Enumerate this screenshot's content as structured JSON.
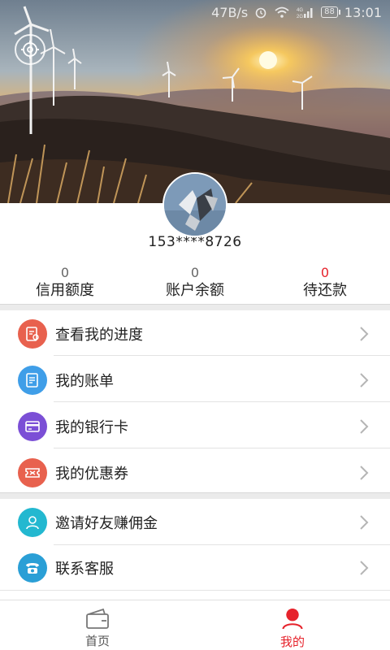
{
  "status_bar": {
    "network_speed": "47B/s",
    "battery": "88",
    "time": "13:01",
    "signal_label": "4G\n2G",
    "icons": [
      "alarm-icon",
      "wifi-icon",
      "signal-icon",
      "battery-icon"
    ]
  },
  "header": {
    "settings_icon": "settings-icon",
    "avatar_icon": "avatar-image"
  },
  "profile": {
    "phone": "153****8726"
  },
  "stats": [
    {
      "value": "0",
      "label": "信用额度",
      "color": "#666666"
    },
    {
      "value": "0",
      "label": "账户余额",
      "color": "#666666"
    },
    {
      "value": "0",
      "label": "待还款",
      "color": "#e6232c"
    }
  ],
  "menu_group1": [
    {
      "label": "查看我的进度",
      "icon": "progress-icon",
      "color": "#e8614e"
    },
    {
      "label": "我的账单",
      "icon": "bill-icon",
      "color": "#3f9ee8"
    },
    {
      "label": "我的银行卡",
      "icon": "bank-card-icon",
      "color": "#7b4fd6"
    },
    {
      "label": "我的优惠券",
      "icon": "coupon-icon",
      "color": "#e8614e"
    }
  ],
  "menu_group2": [
    {
      "label": "邀请好友赚佣金",
      "icon": "invite-icon",
      "color": "#23b8d0"
    },
    {
      "label": "联系客服",
      "icon": "phone-icon",
      "color": "#2a9fd6"
    }
  ],
  "tabbar": [
    {
      "label": "首页",
      "icon": "wallet-icon",
      "active": false
    },
    {
      "label": "我的",
      "icon": "user-icon",
      "active": true
    }
  ],
  "colors": {
    "accent": "#e6232c",
    "divider": "#ebebeb"
  }
}
